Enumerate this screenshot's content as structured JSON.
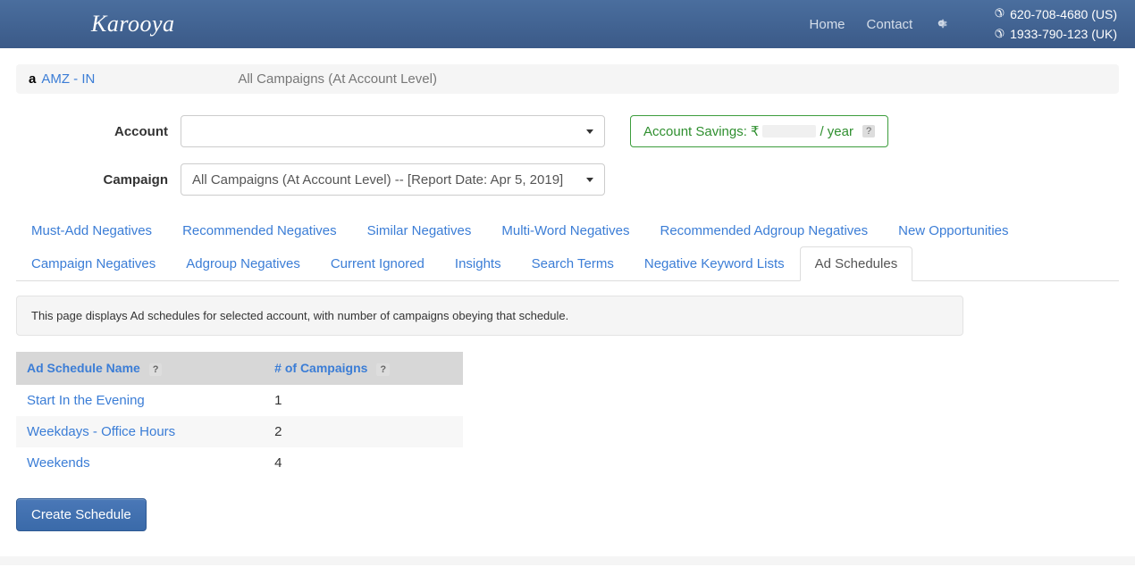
{
  "header": {
    "logo": "Karooya",
    "nav": {
      "home": "Home",
      "contact": "Contact"
    },
    "phones": {
      "us": "620-708-4680 (US)",
      "uk": "1933-790-123 (UK)"
    }
  },
  "breadcrumb": {
    "amz_logo": "a",
    "account_link": "AMZ - IN",
    "campaign": "All Campaigns (At Account Level)"
  },
  "selectors": {
    "account_label": "Account",
    "account_value": "",
    "campaign_label": "Campaign",
    "campaign_value": "All Campaigns (At Account Level) -- [Report Date: Apr 5, 2019]"
  },
  "savings": {
    "label": "Account Savings:",
    "currency": "₹",
    "suffix": "/ year",
    "help": "?"
  },
  "tabs": [
    "Must-Add Negatives",
    "Recommended Negatives",
    "Similar Negatives",
    "Multi-Word Negatives",
    "Recommended Adgroup Negatives",
    "New Opportunities",
    "Campaign Negatives",
    "Adgroup Negatives",
    "Current Ignored",
    "Insights",
    "Search Terms",
    "Negative Keyword Lists",
    "Ad Schedules"
  ],
  "active_tab": "Ad Schedules",
  "info": "This page displays Ad schedules for selected account, with number of campaigns obeying that schedule.",
  "table": {
    "headers": {
      "name": "Ad Schedule Name",
      "count": "# of Campaigns",
      "help": "?"
    },
    "rows": [
      {
        "name": "Start In the Evening",
        "count": "1"
      },
      {
        "name": "Weekdays - Office Hours",
        "count": "2"
      },
      {
        "name": "Weekends",
        "count": "4"
      }
    ]
  },
  "buttons": {
    "create": "Create Schedule"
  }
}
